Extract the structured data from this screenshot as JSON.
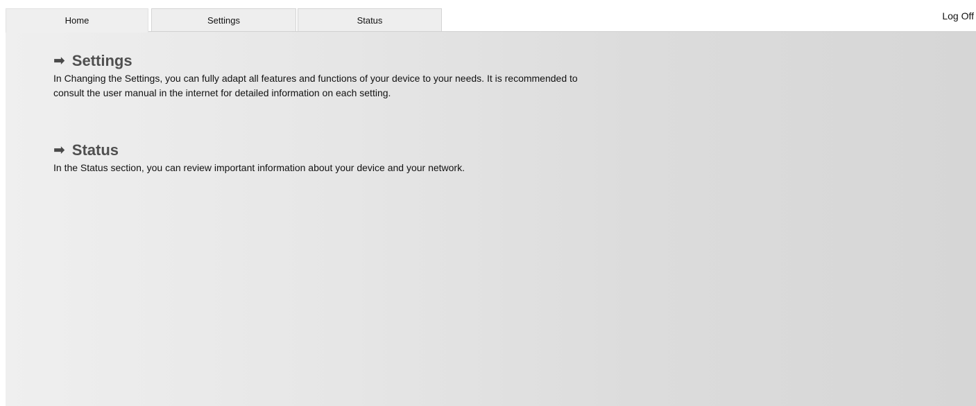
{
  "tabs": [
    {
      "label": "Home",
      "active": true
    },
    {
      "label": "Settings",
      "active": false
    },
    {
      "label": "Status",
      "active": false
    }
  ],
  "logoff_label": "Log Off",
  "main": {
    "sections": [
      {
        "arrow_icon": "right-arrow-icon",
        "title": "Settings",
        "text": "In Changing the Settings, you can fully adapt all features and functions of your device to your needs. It is recommended to consult the user manual in the internet for detailed information on each setting."
      },
      {
        "arrow_icon": "right-arrow-icon",
        "title": "Status",
        "text": "In the Status section, you can review important information about your device and your network."
      }
    ]
  },
  "colors": {
    "heading": "#4f4f4f",
    "tab_background": "#eeeeee",
    "content_gradient_start": "#efefef",
    "content_gradient_end": "#d6d6d6"
  }
}
